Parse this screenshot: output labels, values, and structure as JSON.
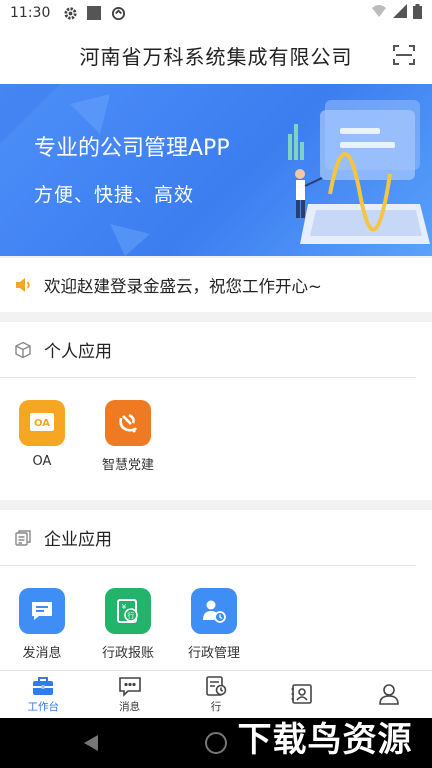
{
  "status_bar": {
    "time": "11:30"
  },
  "header": {
    "title": "河南省万科系统集成有限公司"
  },
  "banner": {
    "title": "专业的公司管理APP",
    "subtitle": "方便、快捷、高效"
  },
  "notice": {
    "text": "欢迎赵建登录金盛云，祝您工作开心~"
  },
  "personal": {
    "title": "个人应用",
    "apps": [
      {
        "label": "OA",
        "icon": "oa-icon",
        "color": "#f5a623"
      },
      {
        "label": "智慧党建",
        "icon": "party-emblem-icon",
        "color": "#f07a21"
      }
    ]
  },
  "enterprise": {
    "title": "企业应用",
    "apps": [
      {
        "label": "发消息",
        "icon": "message-icon",
        "color": "#3f8ef5"
      },
      {
        "label": "行政报账",
        "icon": "reimburse-icon",
        "color": "#22b46a"
      },
      {
        "label": "行政管理",
        "icon": "admin-manage-icon",
        "color": "#3f8ef5"
      }
    ]
  },
  "tabbar": {
    "items": [
      {
        "label": "工作台",
        "icon": "briefcase-icon",
        "active": true
      },
      {
        "label": "消息",
        "icon": "chat-icon",
        "active": false
      },
      {
        "label": "行",
        "icon": "itinerary-icon",
        "active": false
      },
      {
        "label": "",
        "icon": "contacts-icon",
        "active": false
      },
      {
        "label": "",
        "icon": "person-icon",
        "active": false
      }
    ]
  },
  "watermark": {
    "text": "下载鸟资源"
  },
  "colors": {
    "accent": "#2f7bf1",
    "banner": "#4a8cf7"
  }
}
